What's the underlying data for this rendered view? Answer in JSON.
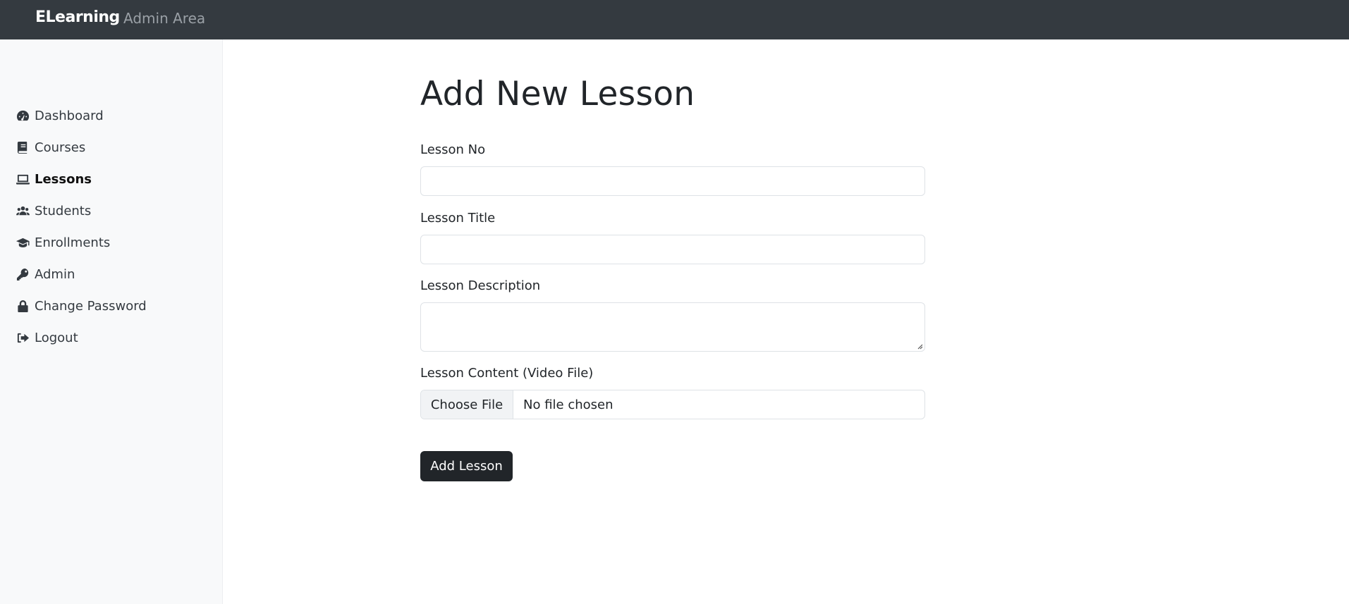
{
  "header": {
    "brand": "ELearning",
    "subtitle": "Admin Area"
  },
  "sidebar": {
    "items": [
      {
        "label": "Dashboard",
        "icon": "dashboard-gauge-icon",
        "active": false
      },
      {
        "label": "Courses",
        "icon": "book-icon",
        "active": false
      },
      {
        "label": "Lessons",
        "icon": "laptop-icon",
        "active": true
      },
      {
        "label": "Students",
        "icon": "users-icon",
        "active": false
      },
      {
        "label": "Enrollments",
        "icon": "graduation-cap-icon",
        "active": false
      },
      {
        "label": "Admin",
        "icon": "key-icon",
        "active": false
      },
      {
        "label": "Change Password",
        "icon": "lock-icon",
        "active": false
      },
      {
        "label": "Logout",
        "icon": "sign-out-icon",
        "active": false
      }
    ]
  },
  "main": {
    "title": "Add New Lesson",
    "form": {
      "lesson_no_label": "Lesson No",
      "lesson_no_value": "",
      "lesson_title_label": "Lesson Title",
      "lesson_title_value": "",
      "lesson_description_label": "Lesson Description",
      "lesson_description_value": "",
      "lesson_content_label": "Lesson Content (Video File)",
      "file_button_label": "Choose File",
      "file_status": "No file chosen",
      "submit_label": "Add Lesson"
    }
  },
  "colors": {
    "topbar": "#343a40",
    "sidebar": "#f8f9fa",
    "button": "#212529"
  }
}
